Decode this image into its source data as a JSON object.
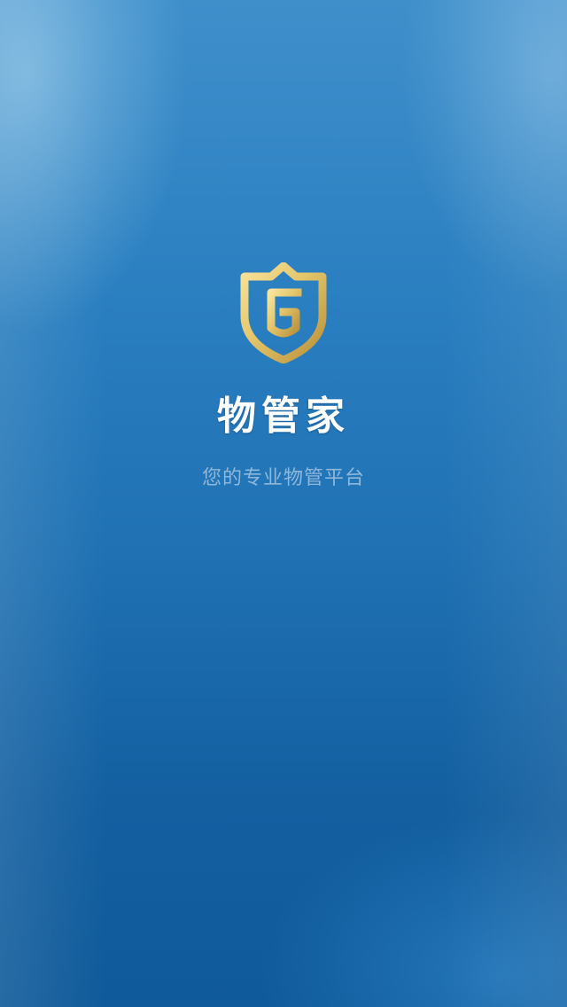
{
  "splash": {
    "app_name": "物管家",
    "tagline": "您的专业物管平台",
    "logo_icon": "gold-shield-g-logo-icon",
    "colors": {
      "background_top": "#3f8fcb",
      "background_bottom": "#0f5a9a",
      "logo_gold": "#e3c46a",
      "tagline": "#8fb7da"
    }
  }
}
